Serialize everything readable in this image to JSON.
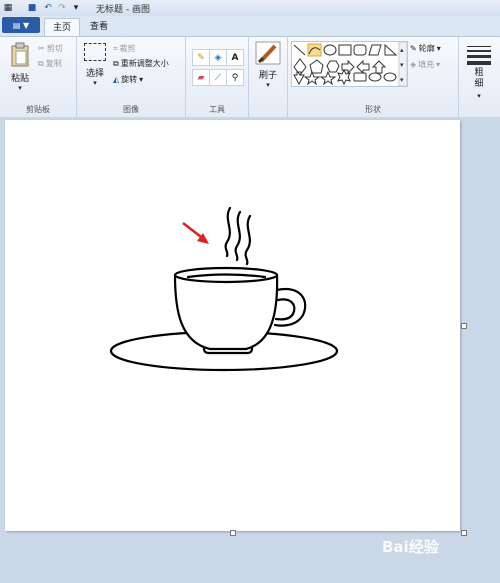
{
  "title_bar": {
    "title": "无标题 - 画图"
  },
  "tabs": {
    "file_menu": "▼",
    "home": "主页",
    "view": "查看"
  },
  "clipboard": {
    "paste": "粘贴",
    "cut": "剪切",
    "copy": "复制",
    "label": "剪贴板"
  },
  "image": {
    "select": "选择",
    "crop": "裁剪",
    "resize": "重新调整大小",
    "rotate": "旋转",
    "label": "图像"
  },
  "tools": {
    "label": "工具",
    "text_glyph": "A"
  },
  "brushes": {
    "label": "刷子"
  },
  "shapes": {
    "outline": "轮廓",
    "fill": "填充",
    "label": "形状"
  },
  "size": {
    "label": "粗细"
  },
  "watermark": {
    "text": "Bai经验"
  }
}
